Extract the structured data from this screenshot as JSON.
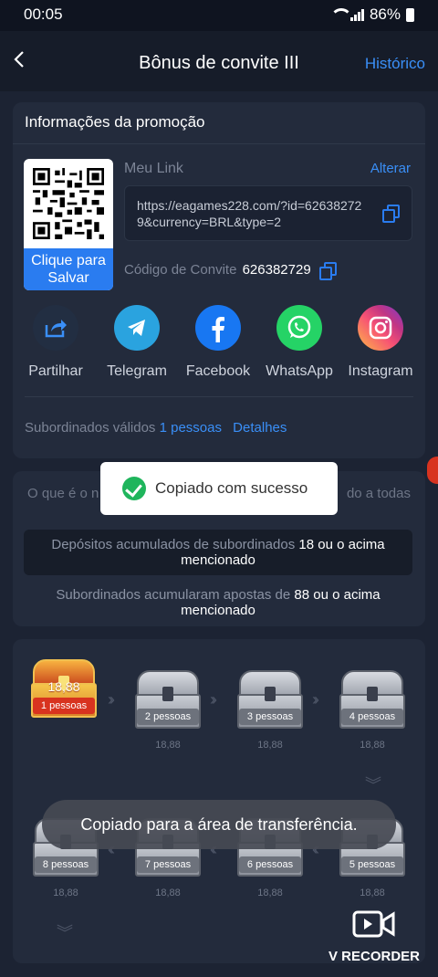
{
  "status": {
    "time": "00:05",
    "battery": "86%"
  },
  "nav": {
    "title": "Bônus de convite III",
    "history": "Histórico"
  },
  "promo": {
    "header": "Informações da promoção",
    "qr_save": "Clique para Salvar",
    "link_label": "Meu Link",
    "change": "Alterar",
    "link": "https://eagames228.com/?id=626382729&currency=BRL&type=2",
    "code_label": "Código de Convite",
    "code": "626382729",
    "share": [
      {
        "label": "Partilhar",
        "icon": "share-icon"
      },
      {
        "label": "Telegram",
        "icon": "telegram-icon"
      },
      {
        "label": "Facebook",
        "icon": "facebook-icon"
      },
      {
        "label": "WhatsApp",
        "icon": "whatsapp-icon"
      },
      {
        "label": "Instagram",
        "icon": "instagram-icon"
      }
    ],
    "valid_label": "Subordinados válidos",
    "valid_count": "1",
    "valid_unit": "pessoas",
    "details": "Detalhes"
  },
  "rules": {
    "question_left": "O que é o n",
    "question_right": "do a todas",
    "rule1_pre": "Depósitos acumulados de subordinados",
    "rule1_val": "18",
    "rule1_post": "ou o acima mencionado",
    "rule2_pre": "Subordinados acumularam apostas de",
    "rule2_val": "88",
    "rule2_post": "ou o acima mencionado"
  },
  "chests": {
    "row1": [
      {
        "tag": "1 pessoas",
        "amount": "18,88",
        "state": "gold"
      },
      {
        "tag": "2 pessoas",
        "amount": "18,88",
        "state": "grey"
      },
      {
        "tag": "3 pessoas",
        "amount": "18,88",
        "state": "grey"
      },
      {
        "tag": "4 pessoas",
        "amount": "18,88",
        "state": "grey"
      }
    ],
    "row2": [
      {
        "tag": "8 pessoas",
        "amount": "18,88",
        "state": "grey"
      },
      {
        "tag": "7 pessoas",
        "amount": "18,88",
        "state": "grey"
      },
      {
        "tag": "6 pessoas",
        "amount": "18,88",
        "state": "grey"
      },
      {
        "tag": "5 pessoas",
        "amount": "18,88",
        "state": "grey"
      }
    ]
  },
  "toasts": {
    "copied": "Copiado com sucesso",
    "clipboard": "Copiado para a área de transferência."
  },
  "recorder": {
    "label": "V RECORDER"
  },
  "colors": {
    "accent": "#3a8ff7",
    "background": "#1c2333",
    "card": "#232b3c",
    "success": "#1fb55c"
  }
}
